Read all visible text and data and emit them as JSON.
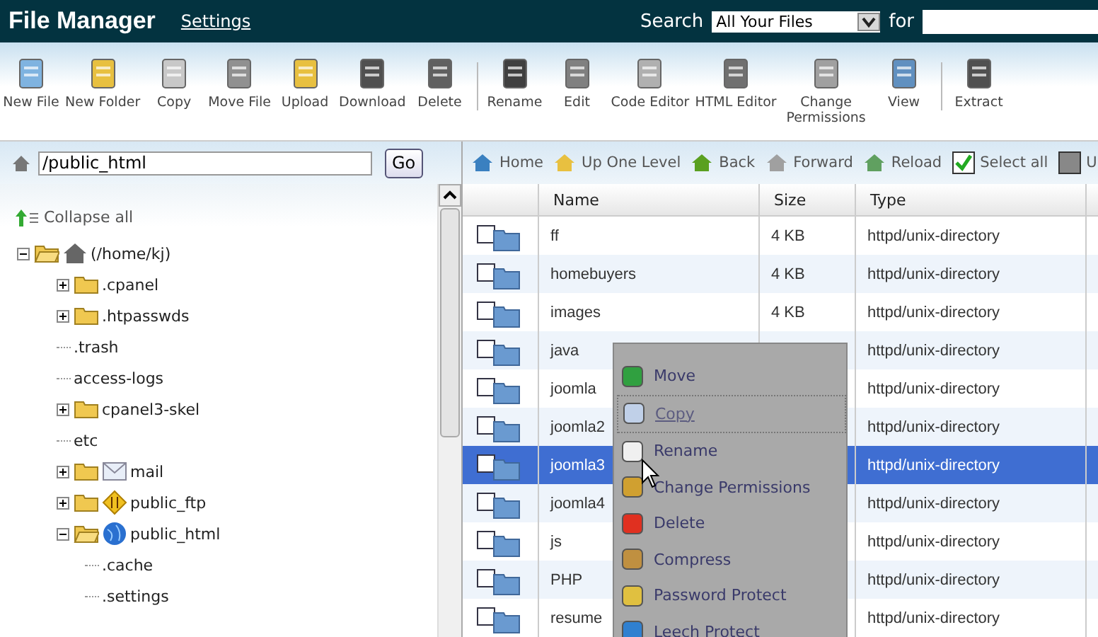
{
  "header": {
    "title": "File Manager",
    "settings_link": "Settings",
    "search_label": "Search",
    "search_scope": "All Your Files",
    "for_label": "for"
  },
  "toolbar": [
    {
      "label": "New File"
    },
    {
      "label": "New Folder"
    },
    {
      "label": "Copy"
    },
    {
      "label": "Move File"
    },
    {
      "label": "Upload"
    },
    {
      "label": "Download"
    },
    {
      "label": "Delete"
    },
    {
      "label": "Rename",
      "group_start": true
    },
    {
      "label": "Edit"
    },
    {
      "label": "Code Editor"
    },
    {
      "label": "HTML Editor"
    },
    {
      "label": "Change Permissions"
    },
    {
      "label": "View"
    },
    {
      "label": "Extract",
      "group_start": true
    }
  ],
  "path_bar": {
    "value": "/public_html",
    "go": "Go"
  },
  "tree": {
    "collapse_all": "Collapse all",
    "items": [
      {
        "label": "(/home/kj)",
        "kind": "home",
        "expanded": true,
        "children": [
          {
            "label": ".cpanel",
            "kind": "folder",
            "expanded": false
          },
          {
            "label": ".htpasswds",
            "kind": "folder",
            "expanded": false
          },
          {
            "label": ".trash",
            "kind": "plain"
          },
          {
            "label": "access-logs",
            "kind": "plain"
          },
          {
            "label": "cpanel3-skel",
            "kind": "folder",
            "expanded": false
          },
          {
            "label": "etc",
            "kind": "plain"
          },
          {
            "label": "mail",
            "kind": "mail",
            "expanded": false
          },
          {
            "label": "public_ftp",
            "kind": "ftp",
            "expanded": false
          },
          {
            "label": "public_html",
            "kind": "web",
            "expanded": true,
            "children": [
              {
                "label": ".cache",
                "kind": "plain"
              },
              {
                "label": ".settings",
                "kind": "plain"
              }
            ]
          }
        ]
      }
    ]
  },
  "nav": [
    {
      "label": "Home"
    },
    {
      "label": "Up One Level"
    },
    {
      "label": "Back"
    },
    {
      "label": "Forward"
    },
    {
      "label": "Reload"
    },
    {
      "label": "Select all",
      "checked": true
    },
    {
      "label": "U",
      "checked": false
    }
  ],
  "table": {
    "columns": [
      "Name",
      "Size",
      "Type"
    ],
    "rows": [
      {
        "name": "ff",
        "size": "4 KB",
        "type": "httpd/unix-directory",
        "selected": false,
        "checked": false
      },
      {
        "name": "homebuyers",
        "size": "4 KB",
        "type": "httpd/unix-directory",
        "selected": false,
        "checked": false
      },
      {
        "name": "images",
        "size": "4 KB",
        "type": "httpd/unix-directory",
        "selected": false,
        "checked": false
      },
      {
        "name": "java",
        "size": "",
        "type": "httpd/unix-directory",
        "selected": false,
        "checked": false
      },
      {
        "name": "joomla",
        "size": "",
        "type": "httpd/unix-directory",
        "selected": false,
        "checked": false
      },
      {
        "name": "joomla2",
        "size": "",
        "type": "httpd/unix-directory",
        "selected": false,
        "checked": false
      },
      {
        "name": "joomla3",
        "size": "",
        "type": "httpd/unix-directory",
        "selected": true,
        "checked": false
      },
      {
        "name": "joomla4",
        "size": "",
        "type": "httpd/unix-directory",
        "selected": false,
        "checked": false
      },
      {
        "name": "js",
        "size": "",
        "type": "httpd/unix-directory",
        "selected": false,
        "checked": false
      },
      {
        "name": "PHP",
        "size": "",
        "type": "httpd/unix-directory",
        "selected": false,
        "checked": false
      },
      {
        "name": "resume",
        "size": "",
        "type": "httpd/unix-directory",
        "selected": false,
        "checked": false
      }
    ]
  },
  "context_menu": [
    {
      "label": "Move",
      "disabled": false
    },
    {
      "label": "Copy",
      "disabled": true
    },
    {
      "label": "Rename",
      "disabled": false
    },
    {
      "label": "Change Permissions",
      "disabled": false
    },
    {
      "label": "Delete",
      "disabled": false
    },
    {
      "label": "Compress",
      "disabled": false
    },
    {
      "label": "Password Protect",
      "disabled": false
    },
    {
      "label": "Leech Protect",
      "disabled": false
    }
  ]
}
